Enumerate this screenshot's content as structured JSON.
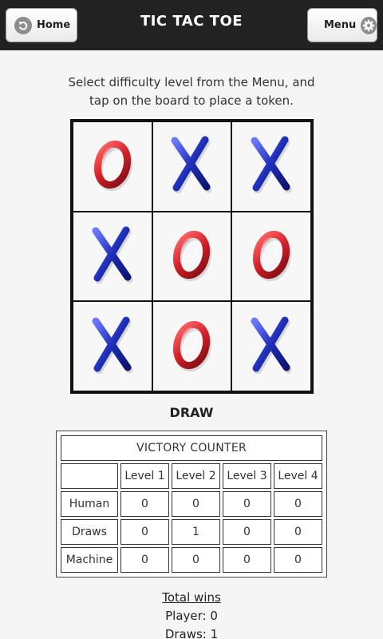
{
  "header": {
    "title": "TIC TAC TOE",
    "home_label": "Home",
    "menu_label": "Menu"
  },
  "instructions": {
    "line1": "Select difficulty level from the Menu, and",
    "line2": "tap on the board to place a token."
  },
  "board": {
    "cells": [
      "O",
      "X",
      "X",
      "X",
      "O",
      "O",
      "X",
      "O",
      "X"
    ],
    "colors": {
      "O": "#d2202a",
      "X": "#1f2fb8"
    }
  },
  "result": "DRAW",
  "victory_counter": {
    "title": "VICTORY COUNTER",
    "levels": [
      "Level 1",
      "Level 2",
      "Level 3",
      "Level 4"
    ],
    "rows": [
      {
        "label": "Human",
        "values": [
          "0",
          "0",
          "0",
          "0"
        ]
      },
      {
        "label": "Draws",
        "values": [
          "0",
          "1",
          "0",
          "0"
        ]
      },
      {
        "label": "Machine",
        "values": [
          "0",
          "0",
          "0",
          "0"
        ]
      }
    ]
  },
  "totals": {
    "heading": "Total wins",
    "player": "Player: 0",
    "draws": "Draws: 1"
  }
}
